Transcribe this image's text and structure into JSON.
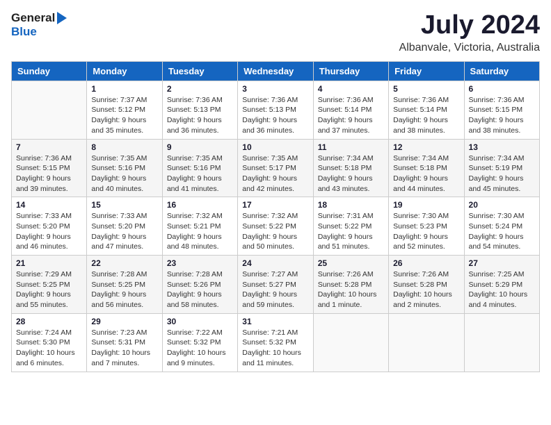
{
  "header": {
    "logo_general": "General",
    "logo_blue": "Blue",
    "month": "July 2024",
    "location": "Albanvale, Victoria, Australia"
  },
  "weekdays": [
    "Sunday",
    "Monday",
    "Tuesday",
    "Wednesday",
    "Thursday",
    "Friday",
    "Saturday"
  ],
  "weeks": [
    [
      {
        "day": "",
        "info": ""
      },
      {
        "day": "1",
        "info": "Sunrise: 7:37 AM\nSunset: 5:12 PM\nDaylight: 9 hours\nand 35 minutes."
      },
      {
        "day": "2",
        "info": "Sunrise: 7:36 AM\nSunset: 5:13 PM\nDaylight: 9 hours\nand 36 minutes."
      },
      {
        "day": "3",
        "info": "Sunrise: 7:36 AM\nSunset: 5:13 PM\nDaylight: 9 hours\nand 36 minutes."
      },
      {
        "day": "4",
        "info": "Sunrise: 7:36 AM\nSunset: 5:14 PM\nDaylight: 9 hours\nand 37 minutes."
      },
      {
        "day": "5",
        "info": "Sunrise: 7:36 AM\nSunset: 5:14 PM\nDaylight: 9 hours\nand 38 minutes."
      },
      {
        "day": "6",
        "info": "Sunrise: 7:36 AM\nSunset: 5:15 PM\nDaylight: 9 hours\nand 38 minutes."
      }
    ],
    [
      {
        "day": "7",
        "info": "Sunrise: 7:36 AM\nSunset: 5:15 PM\nDaylight: 9 hours\nand 39 minutes."
      },
      {
        "day": "8",
        "info": "Sunrise: 7:35 AM\nSunset: 5:16 PM\nDaylight: 9 hours\nand 40 minutes."
      },
      {
        "day": "9",
        "info": "Sunrise: 7:35 AM\nSunset: 5:16 PM\nDaylight: 9 hours\nand 41 minutes."
      },
      {
        "day": "10",
        "info": "Sunrise: 7:35 AM\nSunset: 5:17 PM\nDaylight: 9 hours\nand 42 minutes."
      },
      {
        "day": "11",
        "info": "Sunrise: 7:34 AM\nSunset: 5:18 PM\nDaylight: 9 hours\nand 43 minutes."
      },
      {
        "day": "12",
        "info": "Sunrise: 7:34 AM\nSunset: 5:18 PM\nDaylight: 9 hours\nand 44 minutes."
      },
      {
        "day": "13",
        "info": "Sunrise: 7:34 AM\nSunset: 5:19 PM\nDaylight: 9 hours\nand 45 minutes."
      }
    ],
    [
      {
        "day": "14",
        "info": "Sunrise: 7:33 AM\nSunset: 5:20 PM\nDaylight: 9 hours\nand 46 minutes."
      },
      {
        "day": "15",
        "info": "Sunrise: 7:33 AM\nSunset: 5:20 PM\nDaylight: 9 hours\nand 47 minutes."
      },
      {
        "day": "16",
        "info": "Sunrise: 7:32 AM\nSunset: 5:21 PM\nDaylight: 9 hours\nand 48 minutes."
      },
      {
        "day": "17",
        "info": "Sunrise: 7:32 AM\nSunset: 5:22 PM\nDaylight: 9 hours\nand 50 minutes."
      },
      {
        "day": "18",
        "info": "Sunrise: 7:31 AM\nSunset: 5:22 PM\nDaylight: 9 hours\nand 51 minutes."
      },
      {
        "day": "19",
        "info": "Sunrise: 7:30 AM\nSunset: 5:23 PM\nDaylight: 9 hours\nand 52 minutes."
      },
      {
        "day": "20",
        "info": "Sunrise: 7:30 AM\nSunset: 5:24 PM\nDaylight: 9 hours\nand 54 minutes."
      }
    ],
    [
      {
        "day": "21",
        "info": "Sunrise: 7:29 AM\nSunset: 5:25 PM\nDaylight: 9 hours\nand 55 minutes."
      },
      {
        "day": "22",
        "info": "Sunrise: 7:28 AM\nSunset: 5:25 PM\nDaylight: 9 hours\nand 56 minutes."
      },
      {
        "day": "23",
        "info": "Sunrise: 7:28 AM\nSunset: 5:26 PM\nDaylight: 9 hours\nand 58 minutes."
      },
      {
        "day": "24",
        "info": "Sunrise: 7:27 AM\nSunset: 5:27 PM\nDaylight: 9 hours\nand 59 minutes."
      },
      {
        "day": "25",
        "info": "Sunrise: 7:26 AM\nSunset: 5:28 PM\nDaylight: 10 hours\nand 1 minute."
      },
      {
        "day": "26",
        "info": "Sunrise: 7:26 AM\nSunset: 5:28 PM\nDaylight: 10 hours\nand 2 minutes."
      },
      {
        "day": "27",
        "info": "Sunrise: 7:25 AM\nSunset: 5:29 PM\nDaylight: 10 hours\nand 4 minutes."
      }
    ],
    [
      {
        "day": "28",
        "info": "Sunrise: 7:24 AM\nSunset: 5:30 PM\nDaylight: 10 hours\nand 6 minutes."
      },
      {
        "day": "29",
        "info": "Sunrise: 7:23 AM\nSunset: 5:31 PM\nDaylight: 10 hours\nand 7 minutes."
      },
      {
        "day": "30",
        "info": "Sunrise: 7:22 AM\nSunset: 5:32 PM\nDaylight: 10 hours\nand 9 minutes."
      },
      {
        "day": "31",
        "info": "Sunrise: 7:21 AM\nSunset: 5:32 PM\nDaylight: 10 hours\nand 11 minutes."
      },
      {
        "day": "",
        "info": ""
      },
      {
        "day": "",
        "info": ""
      },
      {
        "day": "",
        "info": ""
      }
    ]
  ]
}
